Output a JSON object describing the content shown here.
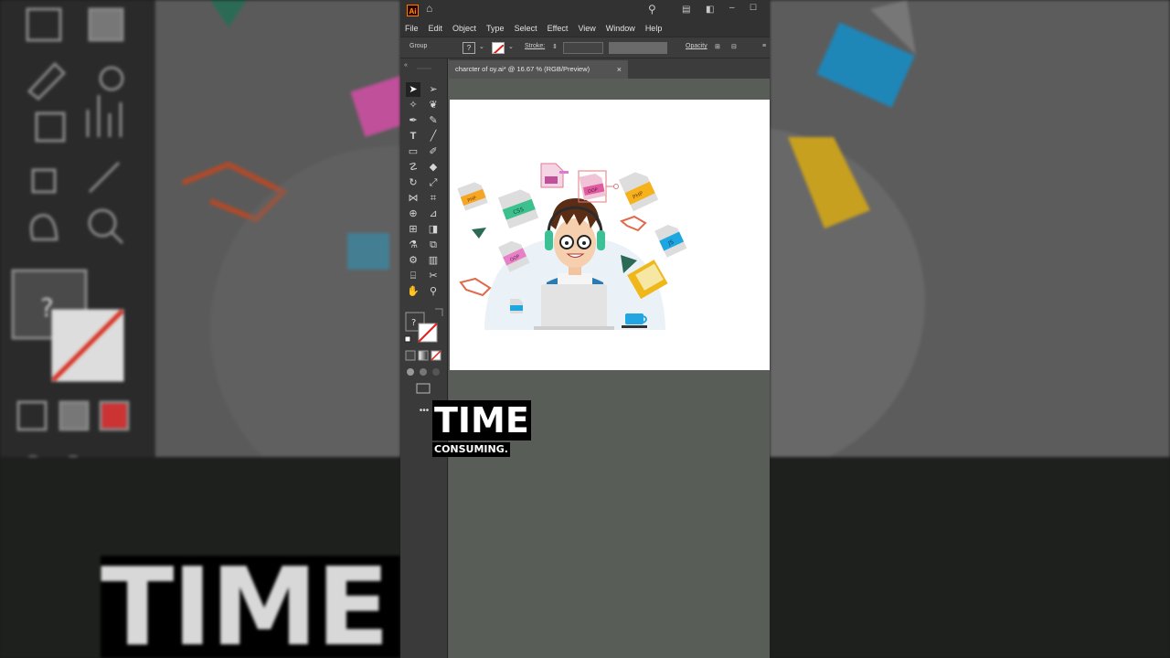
{
  "window": {
    "app_badge": "Ai"
  },
  "menu": {
    "items": [
      "File",
      "Edit",
      "Object",
      "Type",
      "Select",
      "Effect",
      "View",
      "Window",
      "Help"
    ]
  },
  "control_bar": {
    "selection_label": "Group",
    "fill_value": "?",
    "stroke_label": "Stroke:",
    "opacity_label": "Opacity"
  },
  "document": {
    "tab_title": "charcter of oy.ai* @ 16.67 % (RGB/Preview)",
    "close_glyph": "×"
  },
  "artwork_badges": {
    "php": "PHP",
    "css": "CSS",
    "oop": "OOP",
    "js": "JS"
  },
  "caption": {
    "line1": "TIME",
    "line2": "CONSUMING."
  },
  "background": {
    "big_text": "TIME",
    "left_question": "?"
  },
  "colors": {
    "ui_dark": "#323232",
    "ui_mid": "#3a3a3a",
    "canvas": "#585d57",
    "accent_orange": "#ff7c00"
  }
}
